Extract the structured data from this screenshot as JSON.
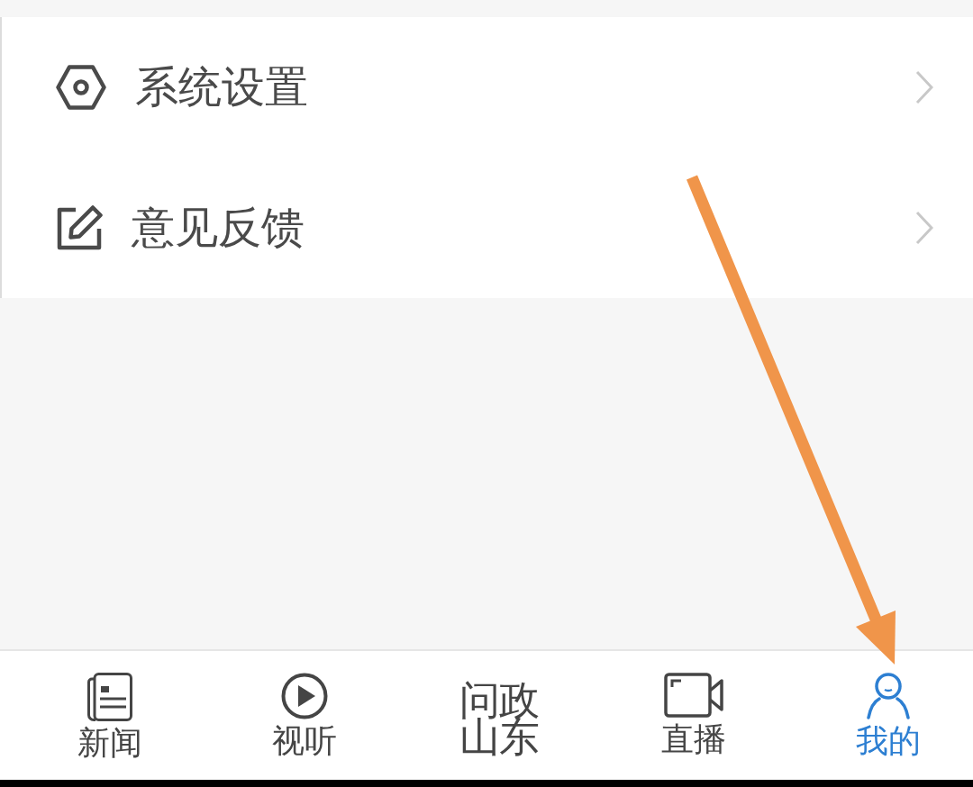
{
  "menu": {
    "items": [
      {
        "label": "系统设置",
        "kind": "settings"
      },
      {
        "label": "意见反馈",
        "kind": "feedback"
      }
    ]
  },
  "tab_bar": {
    "tabs": [
      {
        "label": "新闻",
        "kind": "news",
        "selected": false
      },
      {
        "label": "视听",
        "kind": "media",
        "selected": false
      },
      {
        "label": "问政山东",
        "kind": "logo",
        "selected": false
      },
      {
        "label": "直播",
        "kind": "live",
        "selected": false
      },
      {
        "label": "我的",
        "kind": "profile",
        "selected": true
      }
    ]
  }
}
